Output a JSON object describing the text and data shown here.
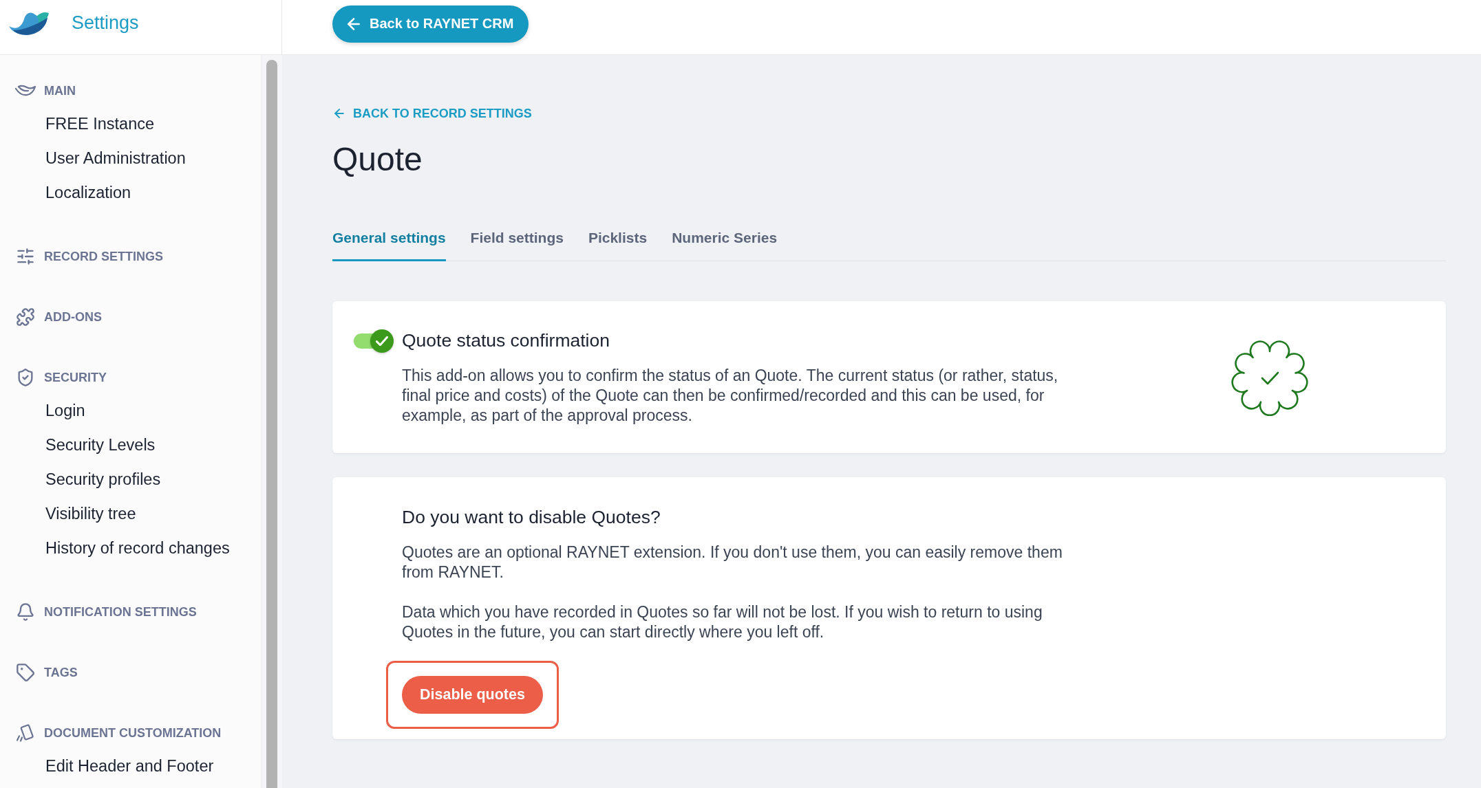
{
  "header": {
    "app_title": "Settings",
    "back_button": {
      "label": "Back to RAYNET CRM"
    }
  },
  "sidebar": {
    "sections": [
      {
        "title": "MAIN",
        "items": [
          "FREE Instance",
          "User Administration",
          "Localization"
        ]
      },
      {
        "title": "RECORD SETTINGS"
      },
      {
        "title": "ADD-ONS"
      },
      {
        "title": "SECURITY",
        "items": [
          "Login",
          "Security Levels",
          "Security profiles",
          "Visibility tree",
          "History of record changes"
        ]
      },
      {
        "title": "NOTIFICATION SETTINGS"
      },
      {
        "title": "TAGS"
      },
      {
        "title": "DOCUMENT CUSTOMIZATION",
        "items": [
          "Edit Header and Footer"
        ]
      }
    ]
  },
  "page": {
    "back_link": "BACK TO RECORD SETTINGS",
    "title": "Quote",
    "tabs": [
      {
        "label": "General settings",
        "selected": true
      },
      {
        "label": "Field settings",
        "selected": false
      },
      {
        "label": "Picklists",
        "selected": false
      },
      {
        "label": "Numeric Series",
        "selected": false
      }
    ],
    "addon_card": {
      "enabled": true,
      "title": "Quote status confirmation",
      "description": "This add-on allows you to confirm the status of an Quote. The current status (or rather, status, final price and costs) of the Quote can then be confirmed/recorded and this can be used, for example, as part of the approval process."
    },
    "disable_card": {
      "title": "Do you want to disable Quotes?",
      "paragraphs": [
        "Quotes are an optional RAYNET extension. If you don't use them, you can easily remove them from RAYNET.",
        "Data which you have recorded in Quotes so far will not be lost. If you wish to return to using Quotes in the future, you can start directly where you left off."
      ],
      "button": {
        "label": "Disable quotes",
        "highlighted": true
      }
    }
  }
}
